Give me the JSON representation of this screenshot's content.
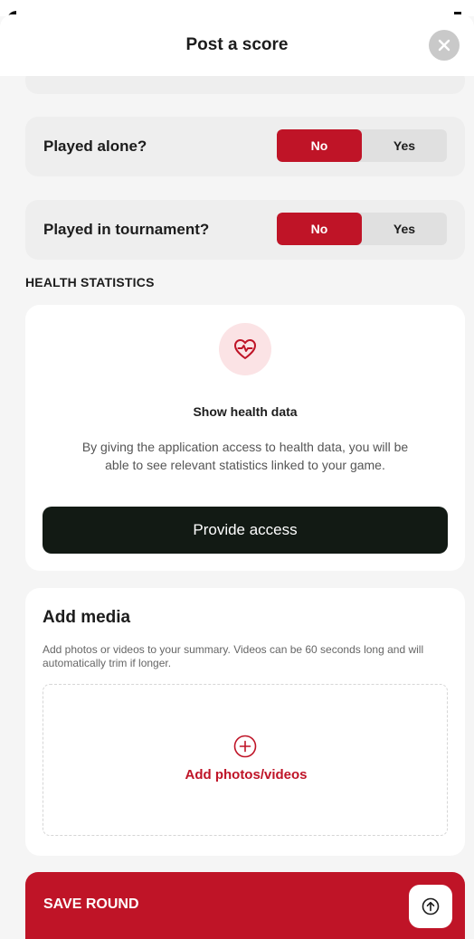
{
  "header": {
    "title": "Post a score"
  },
  "questions": [
    {
      "label": "Played alone?",
      "options": [
        "No",
        "Yes"
      ],
      "selected": "No"
    },
    {
      "label": "Played in tournament?",
      "options": [
        "No",
        "Yes"
      ],
      "selected": "No"
    }
  ],
  "health": {
    "section_title": "HEALTH STATISTICS",
    "title": "Show health data",
    "description": "By giving the application access to health data, you will be able to see relevant statistics linked to your game.",
    "button_label": "Provide access",
    "icon": "heart-pulse-icon"
  },
  "media": {
    "title": "Add media",
    "description": "Add photos or videos to your summary. Videos can be 60 seconds long and will automatically trim if longer.",
    "add_label": "Add photos/videos",
    "icon": "plus-circle-icon"
  },
  "footer": {
    "save_label": "SAVE ROUND",
    "icon": "arrow-up-circle-icon"
  },
  "colors": {
    "accent": "#bf1427",
    "dark_button": "#121a14",
    "card_grey": "#eeeeee",
    "icon_bg": "#fbe3e5"
  }
}
